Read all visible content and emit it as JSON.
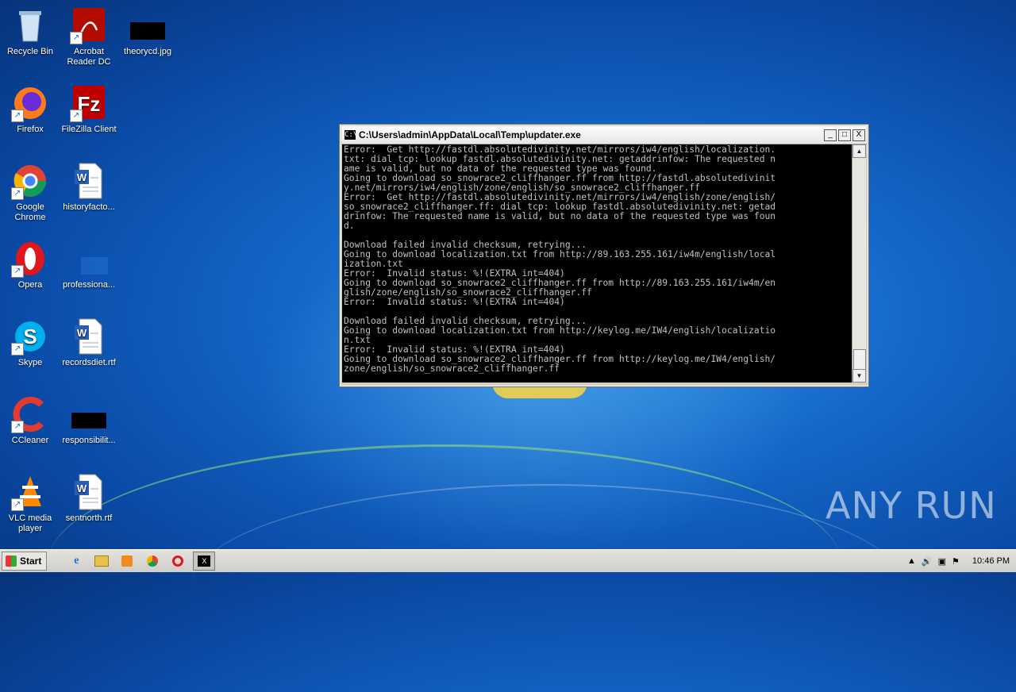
{
  "desktop": {
    "icons": [
      {
        "label": "Recycle Bin"
      },
      {
        "label": "Acrobat Reader DC"
      },
      {
        "label": "theorycd.jpg"
      },
      {
        "label": "Firefox"
      },
      {
        "label": "FileZilla Client"
      },
      {
        "label": "Google Chrome"
      },
      {
        "label": "historyfacto..."
      },
      {
        "label": "Opera"
      },
      {
        "label": "professiona..."
      },
      {
        "label": "Skype"
      },
      {
        "label": "recordsdiet.rtf"
      },
      {
        "label": "CCleaner"
      },
      {
        "label": "responsibilit..."
      },
      {
        "label": "VLC media player"
      },
      {
        "label": "sentnorth.rtf"
      }
    ]
  },
  "window": {
    "title": "C:\\Users\\admin\\AppData\\Local\\Temp\\updater.exe",
    "minimize": "_",
    "maximize": "□",
    "close": "X",
    "console_lines": [
      "Error:  Get http://fastdl.absolutedivinity.net/mirrors/iw4/english/localization.",
      "txt: dial tcp: lookup fastdl.absolutedivinity.net: getaddrinfow: The requested n",
      "ame is valid, but no data of the requested type was found.",
      "Going to download so_snowrace2_cliffhanger.ff from http://fastdl.absolutedivinit",
      "y.net/mirrors/iw4/english/zone/english/so_snowrace2_cliffhanger.ff",
      "Error:  Get http://fastdl.absolutedivinity.net/mirrors/iw4/english/zone/english/",
      "so_snowrace2_cliffhanger.ff: dial tcp: lookup fastdl.absolutedivinity.net: getad",
      "drinfow: The requested name is valid, but no data of the requested type was foun",
      "d.",
      "",
      "Download failed invalid checksum, retrying...",
      "Going to download localization.txt from http://89.163.255.161/iw4m/english/local",
      "ization.txt",
      "Error:  Invalid status: %!(EXTRA int=404)",
      "Going to download so_snowrace2_cliffhanger.ff from http://89.163.255.161/iw4m/en",
      "glish/zone/english/so_snowrace2_cliffhanger.ff",
      "Error:  Invalid status: %!(EXTRA int=404)",
      "",
      "Download failed invalid checksum, retrying...",
      "Going to download localization.txt from http://keylog.me/IW4/english/localizatio",
      "n.txt",
      "Error:  Invalid status: %!(EXTRA int=404)",
      "Going to download so_snowrace2_cliffhanger.ff from http://keylog.me/IW4/english/",
      "zone/english/so_snowrace2_cliffhanger.ff"
    ]
  },
  "taskbar": {
    "start_label": "Start",
    "clock": "10:46 PM"
  },
  "watermark": "ANY RUN"
}
